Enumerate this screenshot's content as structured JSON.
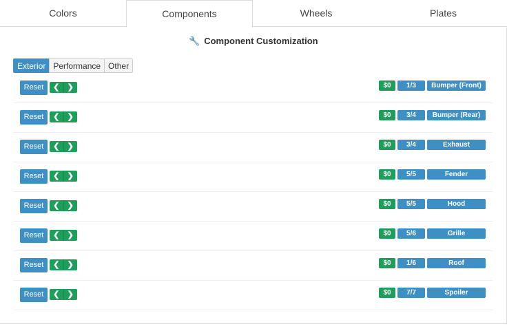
{
  "tabs": [
    {
      "label": "Colors"
    },
    {
      "label": "Components"
    },
    {
      "label": "Wheels"
    },
    {
      "label": "Plates"
    }
  ],
  "active_tab": "Components",
  "heading": {
    "icon": "wrench-icon",
    "text": "Component Customization"
  },
  "subtabs": [
    {
      "label": "Exterior"
    },
    {
      "label": "Performance"
    },
    {
      "label": "Other"
    }
  ],
  "active_subtab": "Exterior",
  "reset_label": "Reset",
  "components": [
    {
      "price": "$0",
      "count": "1/3",
      "name": "Bumper (Front)"
    },
    {
      "price": "$0",
      "count": "3/4",
      "name": "Bumper (Rear)"
    },
    {
      "price": "$0",
      "count": "3/4",
      "name": "Exhaust"
    },
    {
      "price": "$0",
      "count": "5/5",
      "name": "Fender"
    },
    {
      "price": "$0",
      "count": "5/5",
      "name": "Hood"
    },
    {
      "price": "$0",
      "count": "5/6",
      "name": "Grille"
    },
    {
      "price": "$0",
      "count": "1/6",
      "name": "Roof"
    },
    {
      "price": "$0",
      "count": "7/7",
      "name": "Spoiler"
    }
  ],
  "colors": {
    "primary": "#3d8fc4",
    "success": "#1e9e5a"
  }
}
